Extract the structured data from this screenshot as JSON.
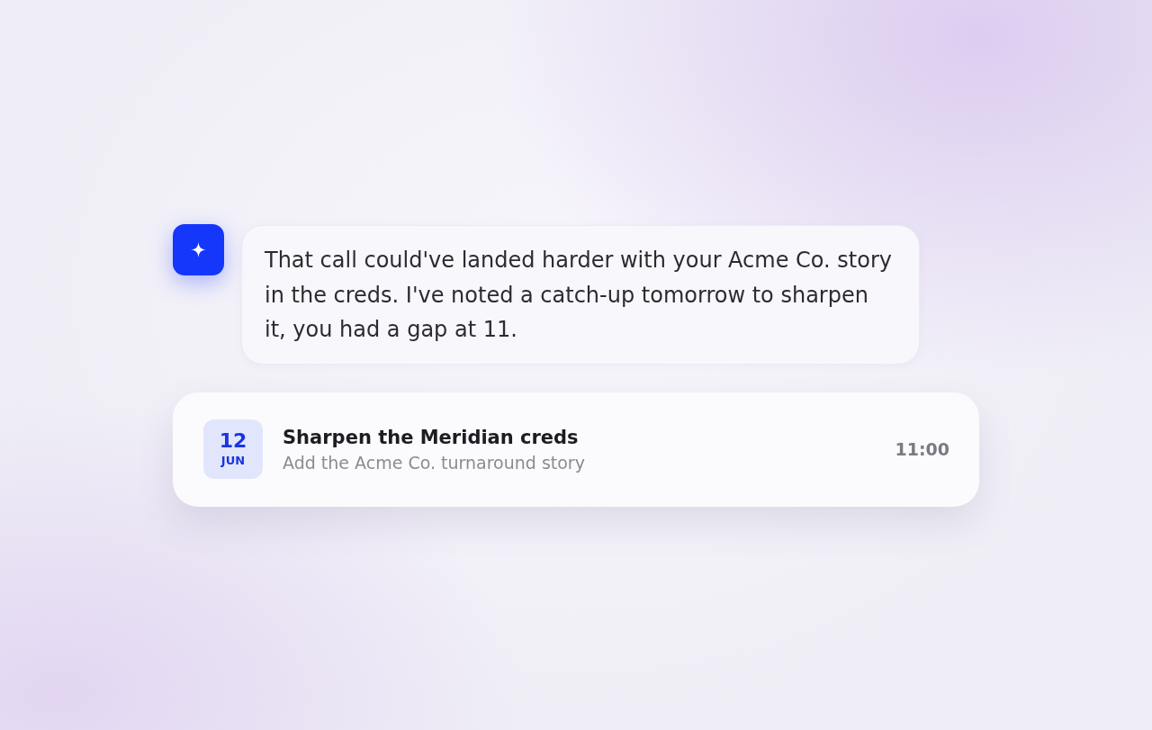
{
  "assistant_message": {
    "text": "That call could've landed harder with your Acme Co. story in the creds. I've noted a catch-up tomorrow to sharpen it, you had a gap at 11."
  },
  "event": {
    "day": "12",
    "month": "JUN",
    "title": "Sharpen the Meridian creds",
    "subtitle": "Add the Acme Co. turnaround story",
    "time": "11:00"
  }
}
